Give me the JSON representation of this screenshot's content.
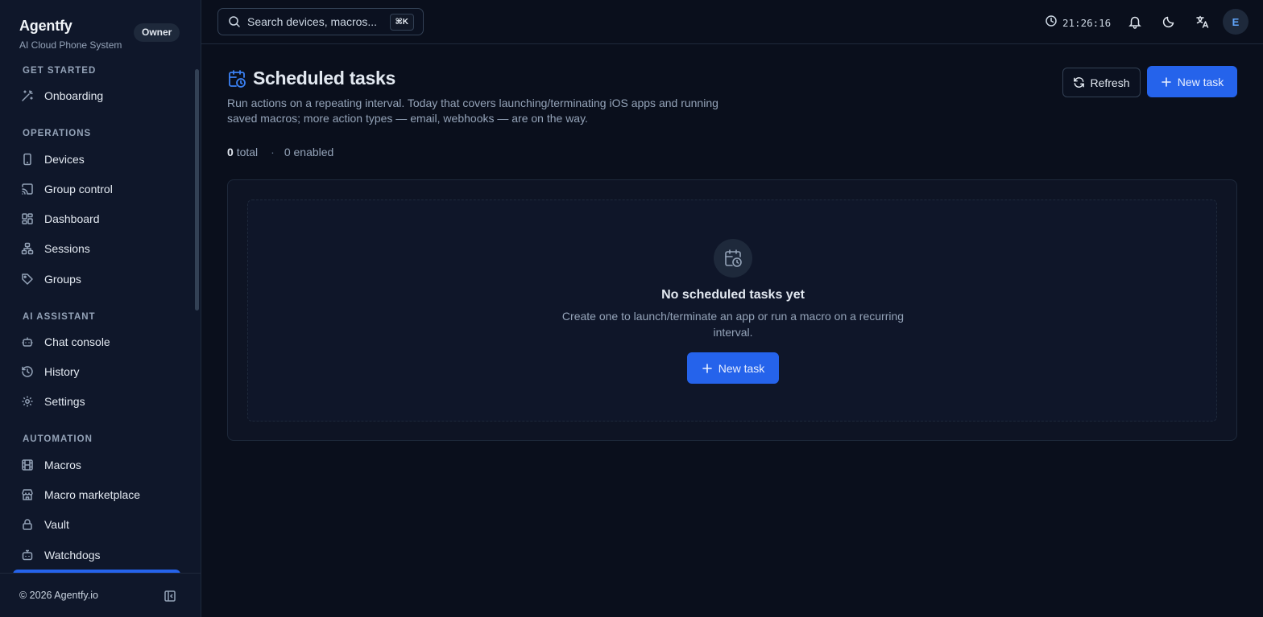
{
  "brand": {
    "name": "Agentfy",
    "subtitle": "AI Cloud Phone System",
    "role_badge": "Owner"
  },
  "sidebar": {
    "sections": [
      {
        "title": "GET STARTED",
        "items": [
          {
            "label": "Onboarding",
            "icon": "wand-icon"
          }
        ]
      },
      {
        "title": "OPERATIONS",
        "items": [
          {
            "label": "Devices",
            "icon": "phone-icon"
          },
          {
            "label": "Group control",
            "icon": "cast-icon"
          },
          {
            "label": "Dashboard",
            "icon": "dashboard-icon"
          },
          {
            "label": "Sessions",
            "icon": "network-icon"
          },
          {
            "label": "Groups",
            "icon": "tag-icon"
          }
        ]
      },
      {
        "title": "AI ASSISTANT",
        "items": [
          {
            "label": "Chat console",
            "icon": "bot-icon"
          },
          {
            "label": "History",
            "icon": "history-icon"
          },
          {
            "label": "Settings",
            "icon": "gear-icon"
          }
        ]
      },
      {
        "title": "AUTOMATION",
        "items": [
          {
            "label": "Macros",
            "icon": "film-icon"
          },
          {
            "label": "Macro marketplace",
            "icon": "store-icon"
          },
          {
            "label": "Vault",
            "icon": "lock-icon"
          },
          {
            "label": "Watchdogs",
            "icon": "robot-icon"
          }
        ]
      }
    ],
    "footer": {
      "copyright": "© 2026 Agentfy.io"
    }
  },
  "topbar": {
    "search_placeholder": "Search devices, macros...",
    "shortcut": "⌘K",
    "time": "21:26:16",
    "avatar_initial": "E"
  },
  "page": {
    "title": "Scheduled tasks",
    "description": "Run actions on a repeating interval. Today that covers launching/terminating iOS apps and running saved macros; more action types — email, webhooks — are on the way.",
    "stats": {
      "total_count": "0",
      "total_label": "total",
      "separator": "·",
      "enabled": "0 enabled"
    },
    "refresh_label": "Refresh",
    "new_task_label": "New task"
  },
  "empty_state": {
    "title": "No scheduled tasks yet",
    "description": "Create one to launch/terminate an app or run a macro on a recurring interval.",
    "button_label": "New task"
  },
  "colors": {
    "accent": "#2563eb",
    "background": "#0a0f1c",
    "sidebar": "#0f172a"
  }
}
